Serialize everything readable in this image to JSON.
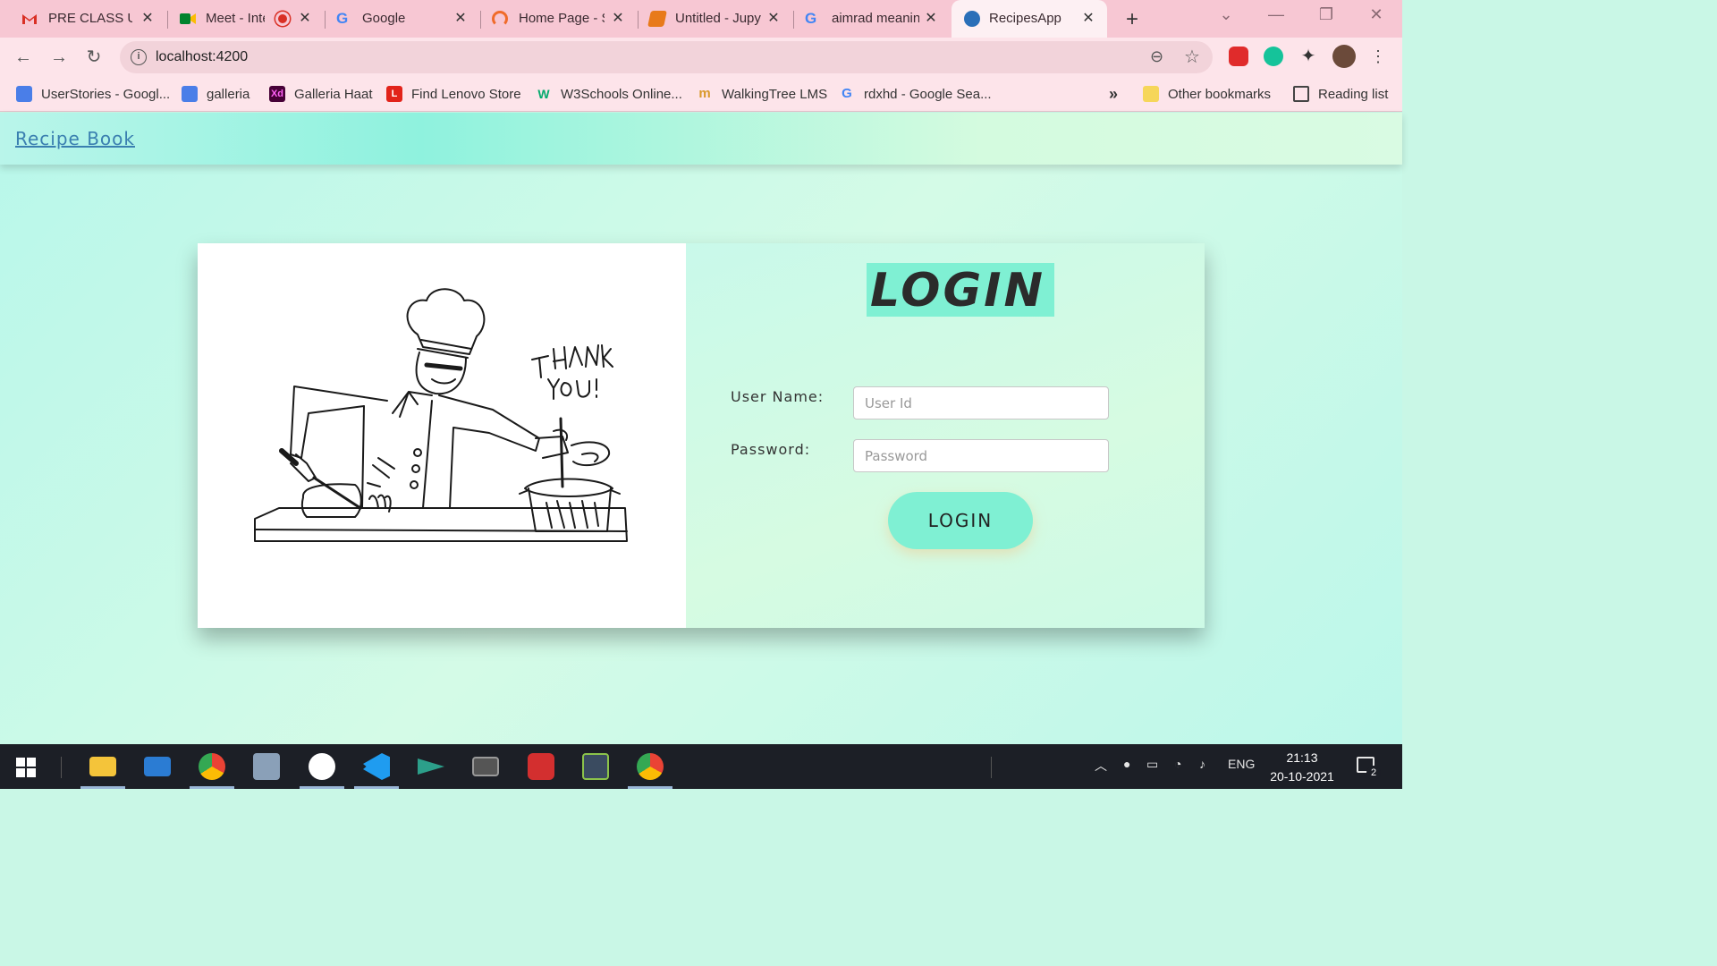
{
  "browser": {
    "tabs": [
      {
        "title": "PRE CLASS UPI",
        "icon": "gmail-icon",
        "color": "#d93025"
      },
      {
        "title": "Meet - Inte",
        "icon": "meet-icon",
        "color": "#188038"
      },
      {
        "title": "Google",
        "icon": "google-icon",
        "color": "#4285f4"
      },
      {
        "title": "Home Page - S",
        "icon": "loading-icon",
        "color": "#f06b2a"
      },
      {
        "title": "Untitled - Jupy",
        "icon": "jupyter-icon",
        "color": "#e87a1a"
      },
      {
        "title": "aimrad meanin",
        "icon": "google-icon",
        "color": "#4285f4"
      },
      {
        "title": "RecipesApp",
        "icon": "recipes-icon",
        "color": "#2a6fb8"
      }
    ],
    "url": "localhost:4200",
    "bookmarks": [
      {
        "label": "UserStories - Googl...",
        "icon": "docs-icon",
        "color": "#4a7ee8"
      },
      {
        "label": "galleria",
        "icon": "docs-icon",
        "color": "#4a7ee8"
      },
      {
        "label": "Galleria Haat",
        "icon": "xd-icon",
        "color": "#470137",
        "glyph": "Xd"
      },
      {
        "label": "Find Lenovo Store",
        "icon": "lenovo-icon",
        "color": "#e2231a",
        "glyph": "L"
      },
      {
        "label": "W3Schools Online...",
        "icon": "w3schools-icon",
        "color": "#04aa6d",
        "glyph": "W"
      },
      {
        "label": "WalkingTree LMS",
        "icon": "walkingtree-icon",
        "color": "#d9982a",
        "glyph": "m"
      },
      {
        "label": "rdxhd - Google Sea...",
        "icon": "google-icon",
        "color": "#4285f4",
        "glyph": "G"
      }
    ],
    "overflow": "»",
    "other_bookmarks": "Other bookmarks",
    "reading_list": "Reading list"
  },
  "app": {
    "brand": "Recipe Book",
    "login_title": "LOGIN",
    "username_label": "User Name:",
    "username_placeholder": "User Id",
    "password_label": "Password:",
    "password_placeholder": "Password",
    "login_button": "LOGIN",
    "illustration_text": "THANK YOU!"
  },
  "taskbar": {
    "language": "ENG",
    "time": "21:13",
    "date": "20-10-2021",
    "notifications": "2"
  }
}
